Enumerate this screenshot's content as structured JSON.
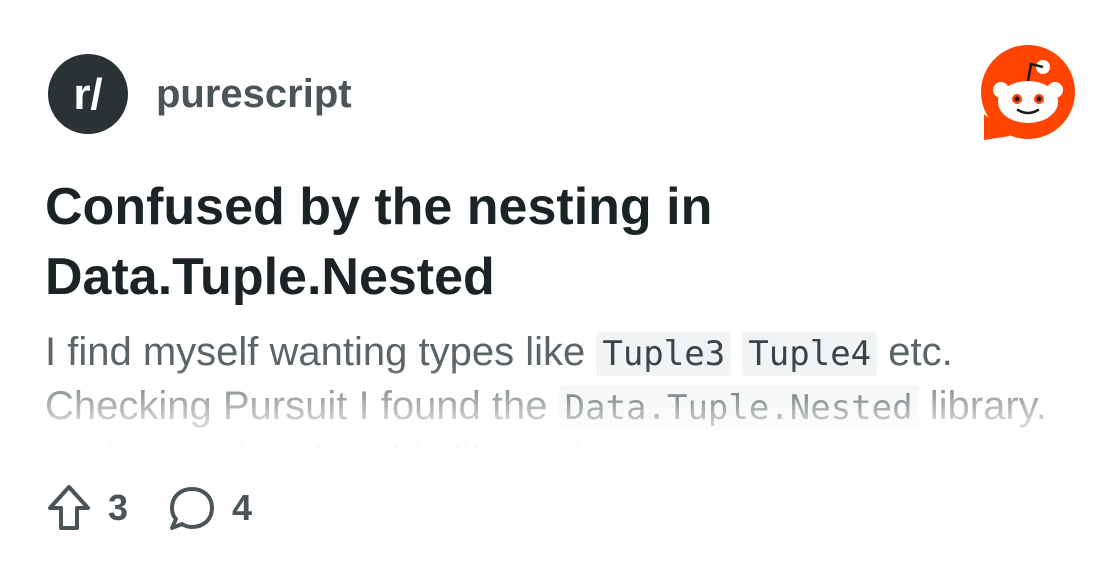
{
  "subreddit": {
    "avatar_text": "r/",
    "name": "purescript"
  },
  "brand": {
    "logo_icon": "reddit-snoo-icon",
    "accent": "#ff4500"
  },
  "post": {
    "title": "Confused by the nesting in Data.Tuple.Nested",
    "body": {
      "t1": "I find myself wanting types like ",
      "c1": "Tuple3",
      "t2": " ",
      "c2": "Tuple4",
      "t3": " etc. Checking Pursuit I found the ",
      "c3": "Data.Tuple.Nested",
      "t4": " library. It's interesting that this library just nests ",
      "c4": "Tuple",
      "t5": "s..."
    }
  },
  "stats": {
    "upvotes": "3",
    "comments": "4",
    "upvote_icon": "upvote-arrow-icon",
    "comment_icon": "comment-bubble-icon"
  }
}
